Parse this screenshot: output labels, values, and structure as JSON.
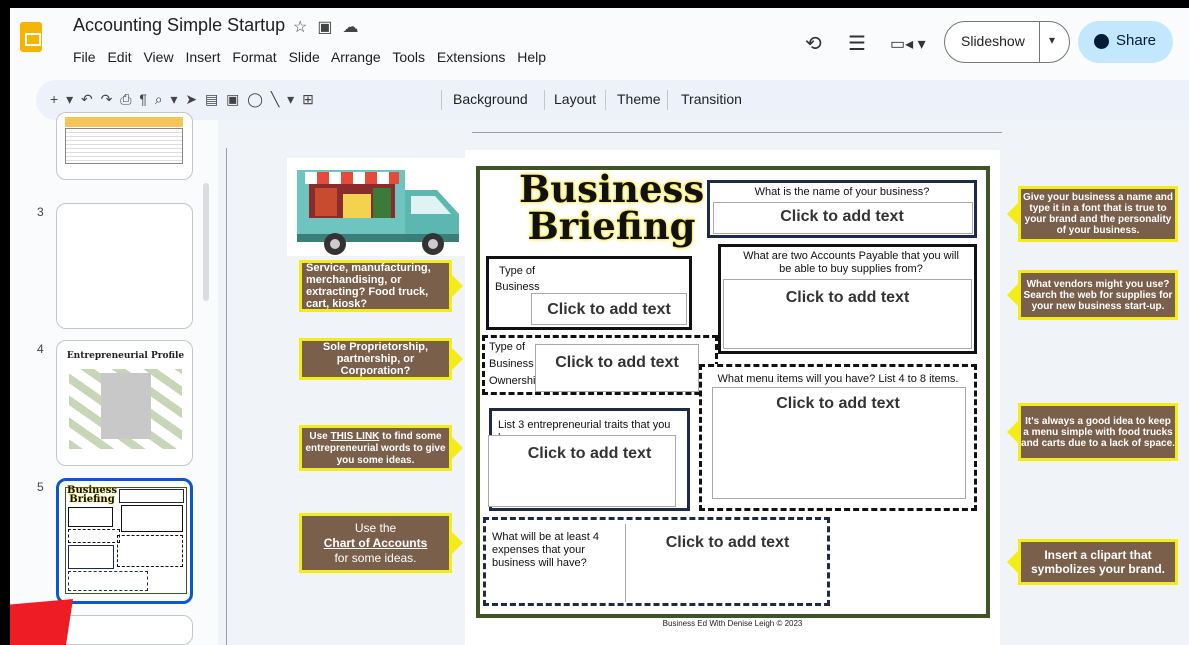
{
  "app": {
    "title": "Accounting Simple Startup",
    "menu": [
      "File",
      "Edit",
      "View",
      "Insert",
      "Format",
      "Slide",
      "Arrange",
      "Tools",
      "Extensions",
      "Help"
    ],
    "slideshow_label": "Slideshow",
    "share_label": "Share",
    "brand_color": "#f4b400"
  },
  "toolbar": {
    "items": [
      "Background",
      "Layout",
      "Theme",
      "Transition"
    ]
  },
  "filmstrip": {
    "slides": [
      {
        "number": "3",
        "caption": ""
      },
      {
        "number": "4",
        "caption": "Entrepreneurial Profile"
      },
      {
        "number": "5",
        "caption": "Business Briefing",
        "selected": true
      }
    ]
  },
  "slide": {
    "title_line1": "Business",
    "title_line2": "Briefing",
    "footer": "Business Ed With Denise Leigh © 2023",
    "placeholder": "Click to add text",
    "boxes": {
      "name": "What is the name of your business?",
      "type_line1": "Type of",
      "type_line2": "Business",
      "payable": "What are two Accounts Payable that you will be able to buy supplies from?",
      "ownership_line1": "Type of",
      "ownership_line2": "Business",
      "ownership_line3": "Ownership",
      "menu": "What menu items will you have? List 4 to 8 items.",
      "traits": "List 3 entrepreneurial traits that you have.",
      "expenses": "What will be at least  4 expenses that your business will have?"
    },
    "callouts_left": {
      "industry": "Service, manufacturing, merchandising, or extracting? Food truck, cart, kiosk?",
      "ownership": "Sole Proprietorship, partnership, or Corporation?",
      "link_pre": "Use ",
      "link_text": "THIS LINK",
      "link_post": " to find some entrepreneurial words to give you some ideas.",
      "chart_pre": "Use the",
      "chart_link": "Chart of Accounts",
      "chart_post": "for some ideas."
    },
    "callouts_right": {
      "name": "Give your business a name and type it in a font that is true to your brand and the personality of your business.",
      "vendors": "What vendors might you use? Search the web for supplies for your new business start-up.",
      "menu": "It's always a good idea to keep a menu simple with food trucks and carts due to a lack of space.",
      "clipart": "Insert a clipart that symbolizes your brand."
    }
  }
}
